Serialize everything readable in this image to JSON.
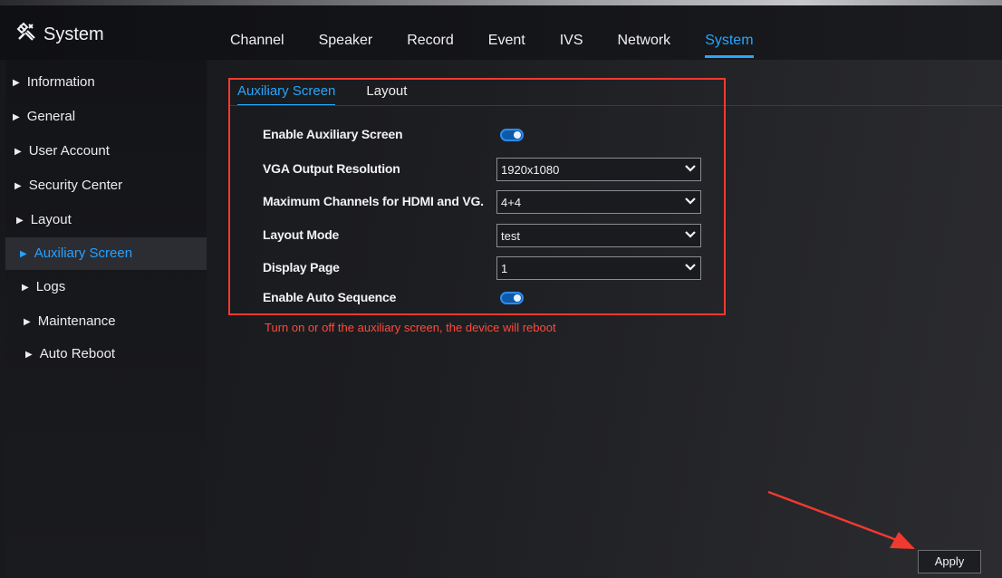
{
  "header": {
    "brand": "System",
    "brand_icon": "tools-icon",
    "tabs": [
      {
        "label": "Channel",
        "active": false
      },
      {
        "label": "Speaker",
        "active": false
      },
      {
        "label": "Record",
        "active": false
      },
      {
        "label": "Event",
        "active": false
      },
      {
        "label": "IVS",
        "active": false
      },
      {
        "label": "Network",
        "active": false
      },
      {
        "label": "System",
        "active": true
      }
    ]
  },
  "sidebar": {
    "items": [
      {
        "label": "Information",
        "active": false
      },
      {
        "label": "General",
        "active": false
      },
      {
        "label": "User Account",
        "active": false
      },
      {
        "label": "Security Center",
        "active": false
      },
      {
        "label": "Layout",
        "active": false
      },
      {
        "label": "Auxiliary Screen",
        "active": true
      },
      {
        "label": "Logs",
        "active": false
      },
      {
        "label": "Maintenance",
        "active": false
      },
      {
        "label": "Auto Reboot",
        "active": false
      }
    ]
  },
  "subtabs": [
    {
      "label": "Auxiliary Screen",
      "active": true
    },
    {
      "label": "Layout",
      "active": false
    }
  ],
  "form": {
    "enable_auxiliary_screen": {
      "label": "Enable Auxiliary Screen",
      "value": true
    },
    "vga_output_resolution": {
      "label": "VGA Output Resolution",
      "value": "1920x1080"
    },
    "max_channels": {
      "label": "Maximum Channels for HDMI and VG.",
      "value": "4+4"
    },
    "layout_mode": {
      "label": "Layout Mode",
      "value": "test"
    },
    "display_page": {
      "label": "Display Page",
      "value": "1"
    },
    "enable_auto_sequence": {
      "label": "Enable Auto Sequence",
      "value": true
    }
  },
  "warning": "Turn on or off the auxiliary screen, the device will reboot",
  "apply_label": "Apply",
  "colors": {
    "accent": "#27a6ff",
    "warning": "#ff4a3a",
    "highlight_box": "#f03a2f",
    "annotation_arrow": "#f03a2f"
  }
}
